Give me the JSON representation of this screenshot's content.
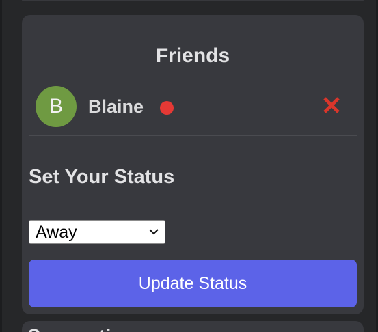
{
  "friends_panel": {
    "title": "Friends",
    "friends": [
      {
        "avatar_initial": "B",
        "avatar_color": "#6f9a42",
        "name": "Blaine",
        "status_color": "#e53935",
        "remove_icon": "close-icon"
      }
    ]
  },
  "status_section": {
    "heading": "Set Your Status",
    "selected": "Away",
    "update_label": "Update Status",
    "button_color": "#5c63e8"
  },
  "next_section": {
    "title": "Suggestions"
  }
}
